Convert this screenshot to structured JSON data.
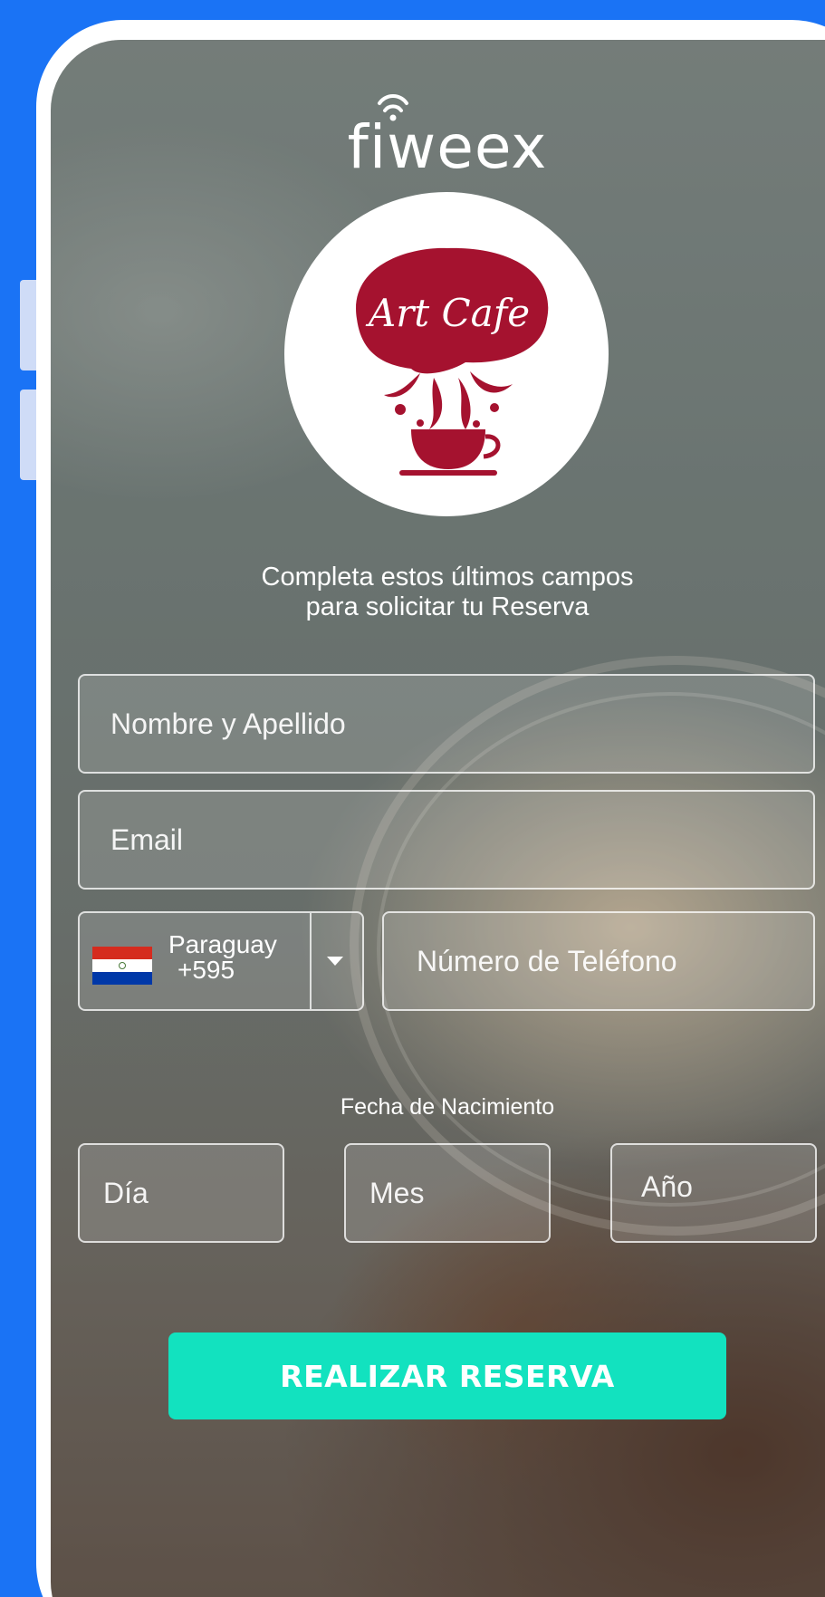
{
  "brand": {
    "name": "fiweex"
  },
  "logo": {
    "text": "Art Cafe",
    "color": "#a5122f"
  },
  "form": {
    "instruction_line1": "Completa estos últimos campos",
    "instruction_line2": "para solicitar tu Reserva",
    "name_placeholder": "Nombre y Apellido",
    "email_placeholder": "Email",
    "country": {
      "name": "Paraguay",
      "code": "+595",
      "flag_colors": [
        "#d52b1e",
        "#ffffff",
        "#0038a8"
      ]
    },
    "phone_placeholder": "Número de Teléfono",
    "dob_label": "Fecha de Nacimiento",
    "day_placeholder": "Día",
    "month_placeholder": "Mes",
    "year_placeholder": "Año",
    "submit_label": "REALIZAR RESERVA"
  },
  "colors": {
    "background": "#1a73f5",
    "accent": "#12e2bf"
  }
}
